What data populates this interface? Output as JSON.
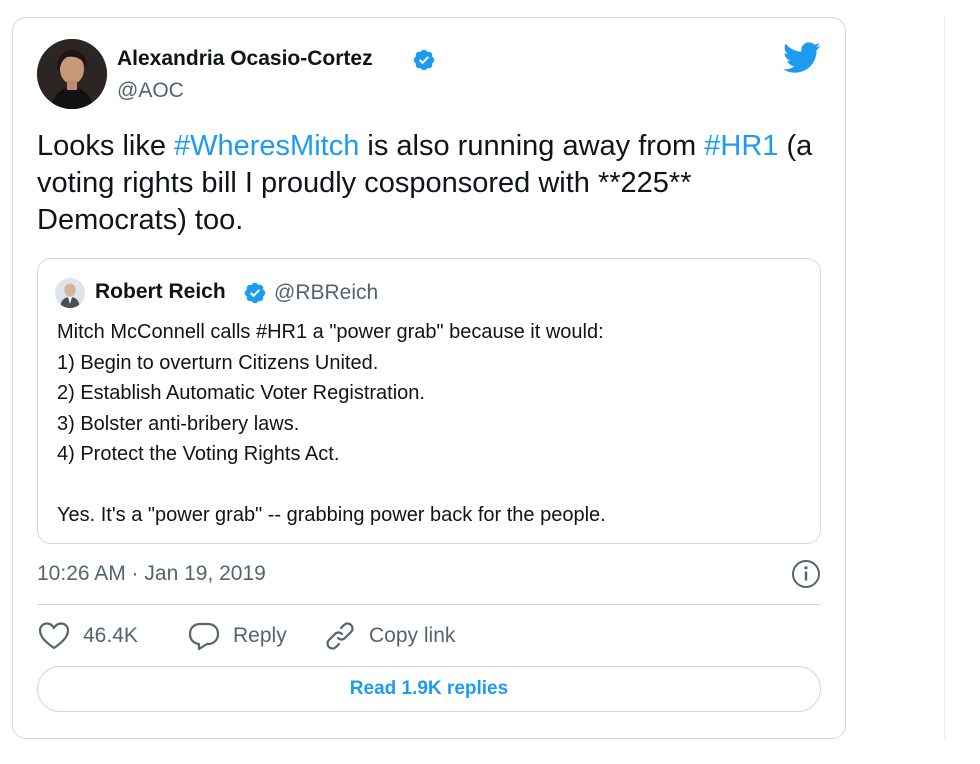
{
  "tweet": {
    "author_name": "Alexandria Ocasio-Cortez",
    "author_handle": "@AOC",
    "text_parts": {
      "p1": "Looks like ",
      "tag1": "#WheresMitch",
      "p2": " is also running away from ",
      "tag2": "#HR1",
      "p3": " (a voting rights bill I proudly cosponsored with **225** Democrats) too."
    },
    "timestamp": "10:26 AM · Jan 19, 2019"
  },
  "quote": {
    "author_name": "Robert Reich",
    "author_handle": "@RBReich",
    "lines": [
      "Mitch McConnell calls #HR1 a \"power grab\" because it would:",
      "1) Begin to overturn Citizens United.",
      "2) Establish Automatic Voter Registration.",
      "3) Bolster anti-bribery laws.",
      "4) Protect the Voting Rights Act.",
      "Yes. It's a \"power grab\" -- grabbing power back for the people."
    ]
  },
  "actions": {
    "like_count": "46.4K",
    "reply_label": "Reply",
    "copy_link_label": "Copy link",
    "read_replies_label": "Read 1.9K replies"
  },
  "icons": {
    "verified": "verified-badge-icon",
    "bird": "twitter-bird-icon",
    "info": "info-icon",
    "like": "heart-icon",
    "reply": "reply-bubble-icon",
    "link": "link-icon"
  },
  "colors": {
    "accent": "#1d9bf0",
    "secondary_text": "#536471",
    "border": "#cfd9de"
  }
}
